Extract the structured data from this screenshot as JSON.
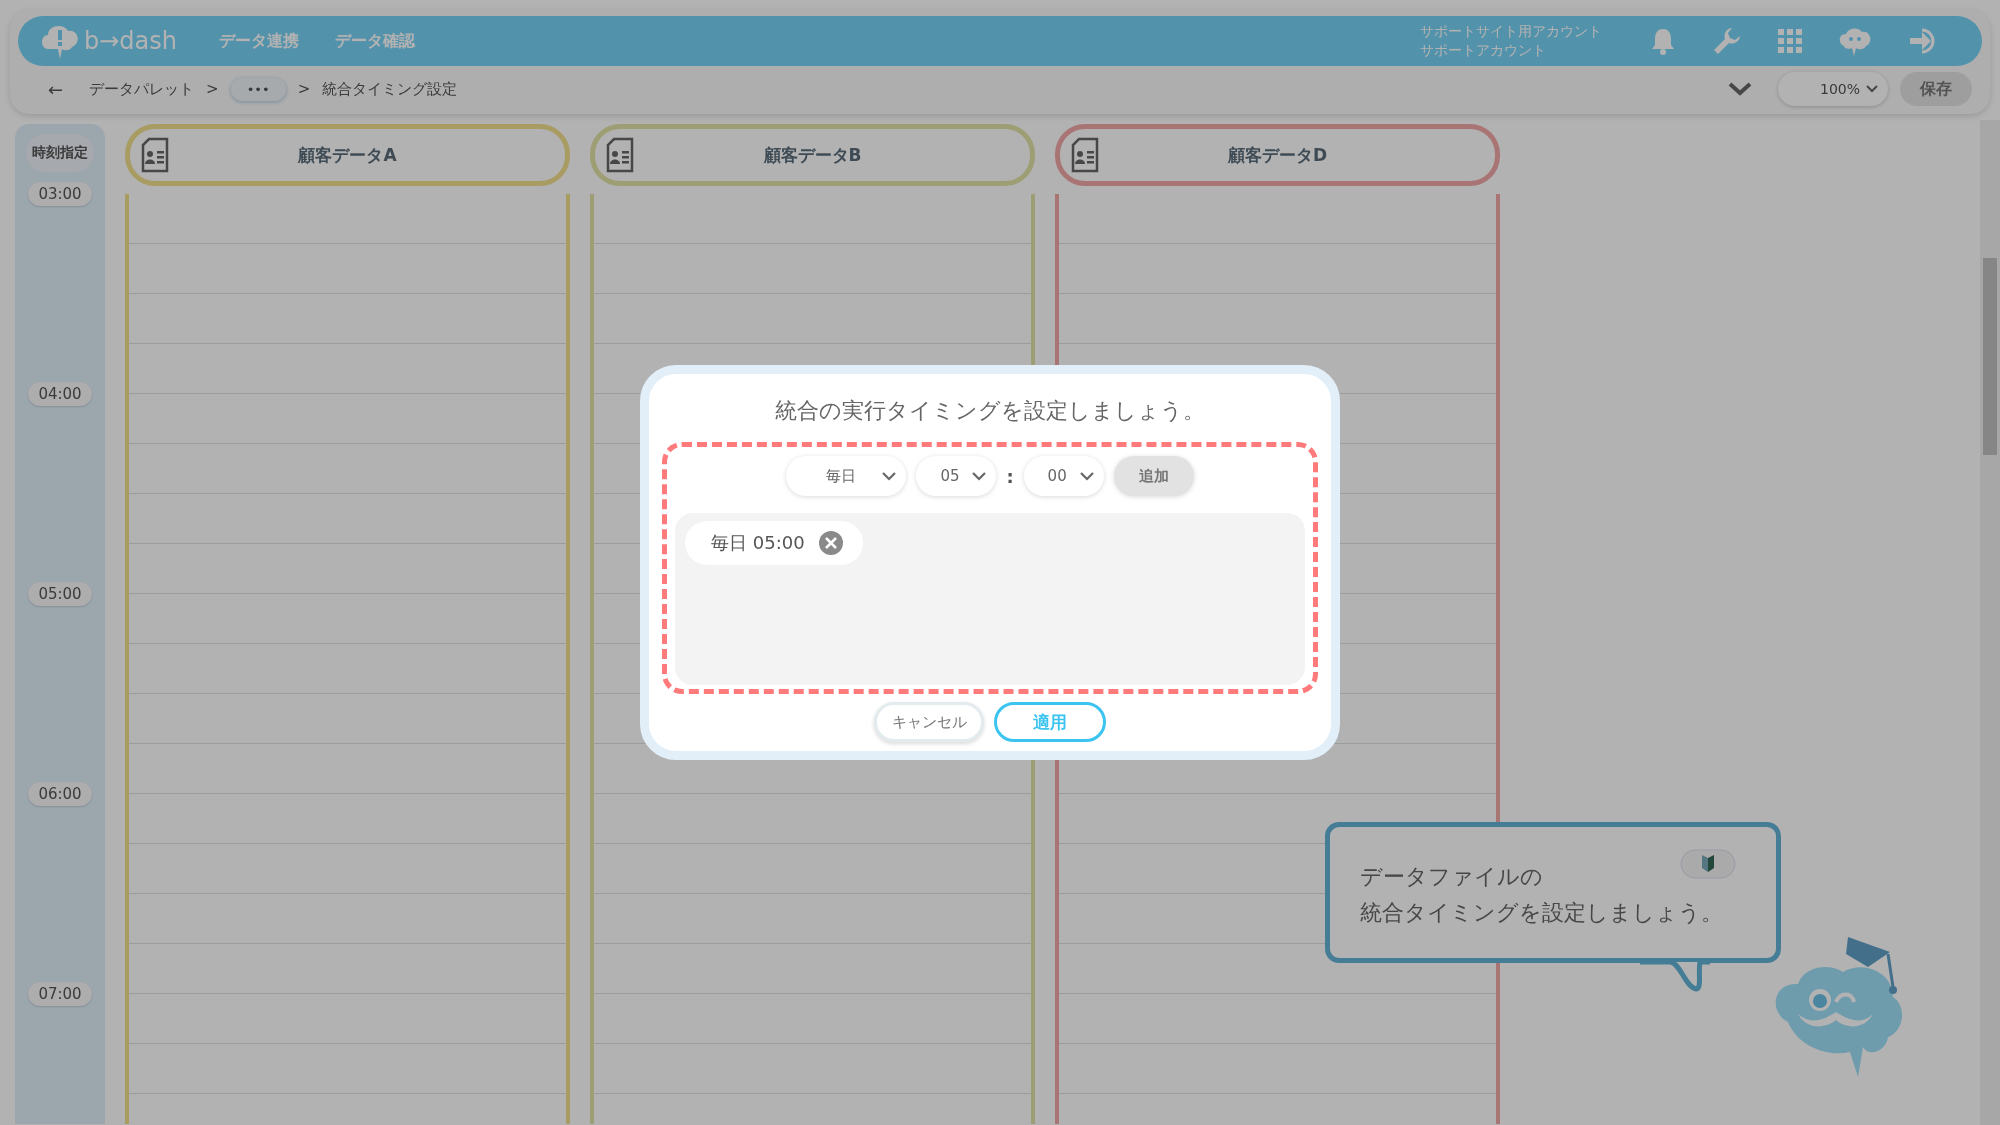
{
  "header": {
    "logo": "b→dash",
    "nav": [
      {
        "label": "データ連携"
      },
      {
        "label": "データ確認"
      }
    ],
    "account": [
      "サポートサイト用アカウント",
      "サポートアカウント"
    ]
  },
  "breadcrumb": {
    "back": "←",
    "items": [
      {
        "kind": "text",
        "label": "データパレット"
      },
      {
        "kind": "sep",
        "label": ">"
      },
      {
        "kind": "more",
        "label": "•••"
      },
      {
        "kind": "sep",
        "label": ">"
      },
      {
        "kind": "text",
        "label": "統合タイミング設定"
      }
    ]
  },
  "toolbar": {
    "zoom": "100%",
    "save": {
      "label": "保存",
      "disabled": true
    }
  },
  "time_header": "時刻指定",
  "columns": [
    {
      "title": "顧客データA",
      "color": "#aa9d64"
    },
    {
      "title": "顧客データB",
      "color": "#9f9e74"
    },
    {
      "title": "顧客データD",
      "color": "#a97575"
    }
  ],
  "time_labels": [
    "03:00",
    "04:00",
    "05:00",
    "06:00",
    "07:00"
  ],
  "modal": {
    "title": "統合の実行タイミングを設定しましょう。",
    "frequency": "毎日",
    "hour": "05",
    "separator": ":",
    "minute": "00",
    "add": {
      "label": "追加",
      "disabled": true
    },
    "schedules": [
      {
        "label": "毎日 05:00"
      }
    ],
    "cancel": "キャンセル",
    "apply": "適用"
  },
  "tooltip": {
    "lines": [
      "データファイルの",
      "統合タイミングを設定しましょう。"
    ]
  }
}
